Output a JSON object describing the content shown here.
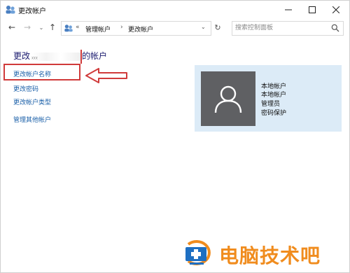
{
  "window": {
    "title": "更改帐户"
  },
  "nav": {
    "breadcrumb": [
      "管理帐户",
      "更改帐户"
    ],
    "overflow_chevron": "«",
    "search_placeholder": "搜索控制面板"
  },
  "main": {
    "heading_left": "更改",
    "heading_obscured": "ᵡᵡᵡ",
    "heading_right": "的帐户",
    "links": [
      "更改帐户名称",
      "更改密码",
      "更改帐户类型",
      "管理其他帐户"
    ]
  },
  "account": {
    "lines": [
      "本地帐户",
      "本地帐户",
      "管理员",
      "密码保护"
    ]
  },
  "watermark": {
    "text": "电脑技术吧"
  },
  "colors": {
    "accent_link": "#1a5fa8",
    "highlight_red": "#d03a3a",
    "tile_bg": "#dcebf7",
    "avatar_bg": "#5f6063",
    "watermark_orange": "#f08c1e"
  },
  "icons": [
    "control-panel-icon",
    "back-arrow-icon",
    "forward-arrow-icon",
    "recent-locations-icon",
    "up-arrow-icon",
    "refresh-icon",
    "search-icon",
    "user-avatar-icon",
    "minimize-icon",
    "maximize-icon",
    "close-icon"
  ]
}
